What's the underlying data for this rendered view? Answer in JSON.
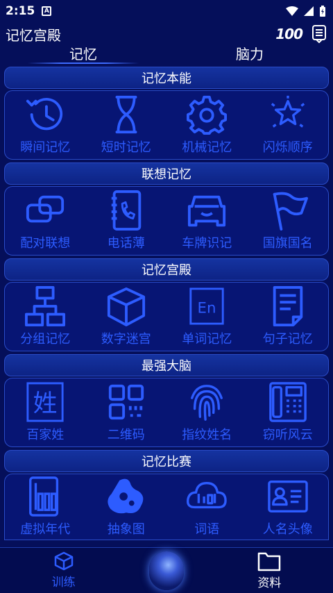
{
  "status": {
    "time": "2:15"
  },
  "app": {
    "title": "记忆宫殿"
  },
  "tabs": [
    {
      "label": "记忆"
    },
    {
      "label": "脑力"
    }
  ],
  "sections": [
    {
      "title": "记忆本能",
      "items": [
        "瞬间记忆",
        "短时记忆",
        "机械记忆",
        "闪烁顺序"
      ]
    },
    {
      "title": "联想记忆",
      "items": [
        "配对联想",
        "电话薄",
        "车牌识记",
        "国旗国名"
      ]
    },
    {
      "title": "记忆宫殿",
      "items": [
        "分组记忆",
        "数字迷宫",
        "单词记忆",
        "句子记忆"
      ]
    },
    {
      "title": "最强大脑",
      "items": [
        "百家姓",
        "二维码",
        "指纹姓名",
        "窃听风云"
      ]
    },
    {
      "title": "记忆比赛",
      "items": [
        "虚拟年代",
        "抽象图",
        "词语",
        "人名头像"
      ]
    }
  ],
  "icon_glyphs": {
    "family_name": "姓",
    "english": "En"
  },
  "bottom_nav": [
    {
      "label": "训练"
    },
    {
      "label": "资料"
    }
  ],
  "colors": {
    "background": "#050f5a",
    "accent": "#2d5cff",
    "border": "#2a4cc8"
  }
}
